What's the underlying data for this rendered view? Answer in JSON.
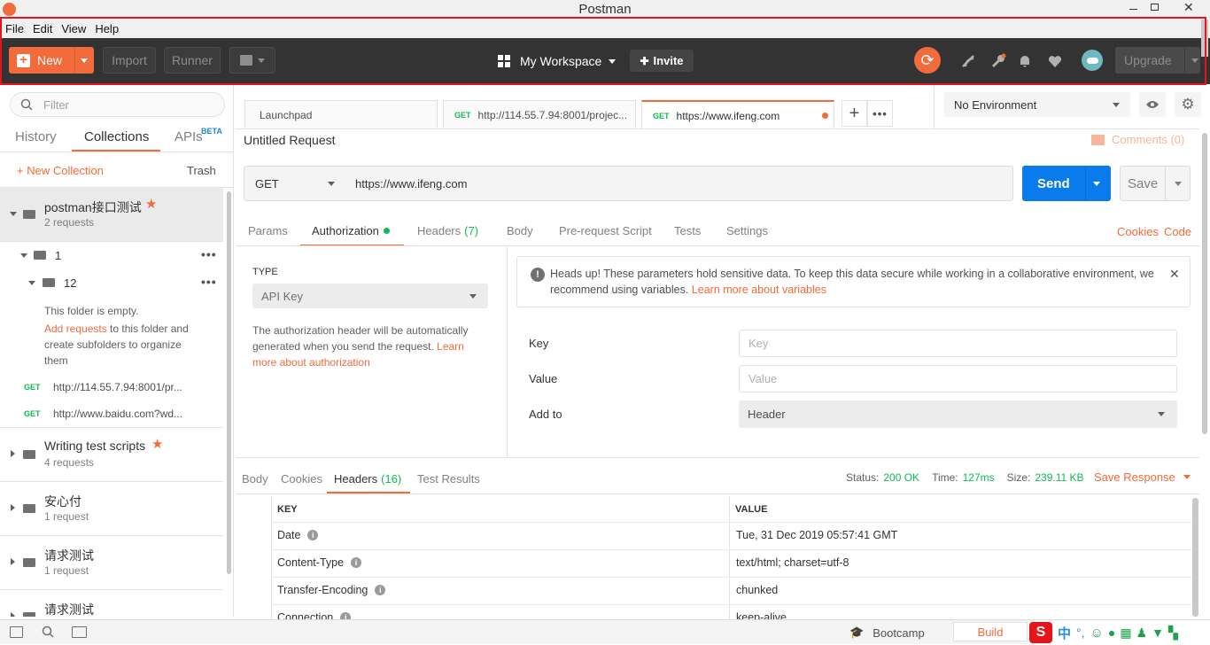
{
  "window": {
    "title": "Postman"
  },
  "menu": [
    "File",
    "Edit",
    "View",
    "Help"
  ],
  "toolbar": {
    "new_label": "New",
    "import_label": "Import",
    "runner_label": "Runner",
    "workspace_label": "My Workspace",
    "invite_label": "Invite",
    "upgrade_label": "Upgrade"
  },
  "sidebar": {
    "filter_placeholder": "Filter",
    "tabs": {
      "history": "History",
      "collections": "Collections",
      "apis": "APIs",
      "beta": "BETA"
    },
    "new_collection": "+ New Collection",
    "trash": "Trash",
    "collections": [
      {
        "name": "postman接口测试",
        "count": "2 requests",
        "starred": true
      },
      {
        "name": "Writing test scripts",
        "count": "4 requests",
        "starred": true
      },
      {
        "name": "安心付",
        "count": "1 request"
      },
      {
        "name": "请求测试",
        "count": "1 request"
      },
      {
        "name": "请求测试",
        "count": ""
      }
    ],
    "folder1": "1",
    "folder12": "12",
    "empty_text": "This folder is empty.",
    "add_requests": "Add requests",
    "empty_rest1": " to this folder and",
    "empty_rest2": "create subfolders to organize",
    "empty_rest3": "them",
    "requests": [
      {
        "method": "GET",
        "url": "http://114.55.7.94:8001/pr..."
      },
      {
        "method": "GET",
        "url": "http://www.baidu.com?wd..."
      }
    ]
  },
  "tabs": [
    {
      "label": "Launchpad"
    },
    {
      "method": "GET",
      "label": "http://114.55.7.94:8001/projec..."
    },
    {
      "method": "GET",
      "label": "https://www.ifeng.com"
    }
  ],
  "environment": {
    "selected": "No Environment"
  },
  "request": {
    "title": "Untitled Request",
    "comments": "Comments (0)",
    "method": "GET",
    "url": "https://www.ifeng.com",
    "send": "Send",
    "save": "Save"
  },
  "request_tabs": {
    "params": "Params",
    "authorization": "Authorization",
    "headers": "Headers",
    "headers_count": "(7)",
    "body": "Body",
    "prerequest": "Pre-request Script",
    "tests": "Tests",
    "settings": "Settings",
    "cookies": "Cookies",
    "code": "Code"
  },
  "auth": {
    "type_label": "TYPE",
    "type_value": "API Key",
    "desc1": "The authorization header will be automatically",
    "desc2": "generated when you send the request. ",
    "desc_link1": "Learn",
    "desc_link2": "more about authorization",
    "notice1": "Heads up! These parameters hold sensitive data. To keep this data secure while working in a collaborative environment, we",
    "notice2": "recommend using variables. ",
    "notice_link": "Learn more about variables",
    "key_label": "Key",
    "key_placeholder": "Key",
    "value_label": "Value",
    "value_placeholder": "Value",
    "addto_label": "Add to",
    "addto_value": "Header"
  },
  "response": {
    "tabs": {
      "body": "Body",
      "cookies": "Cookies",
      "headers": "Headers",
      "headers_count": "(16)",
      "test_results": "Test Results"
    },
    "status_label": "Status:",
    "status_value": "200 OK",
    "time_label": "Time:",
    "time_value": "127ms",
    "size_label": "Size:",
    "size_value": "239.11 KB",
    "save_response": "Save Response",
    "columns": [
      "KEY",
      "VALUE"
    ],
    "headers": [
      {
        "key": "Date",
        "value": "Tue, 31 Dec 2019 05:57:41 GMT"
      },
      {
        "key": "Content-Type",
        "value": "text/html; charset=utf-8"
      },
      {
        "key": "Transfer-Encoding",
        "value": "chunked"
      },
      {
        "key": "Connection",
        "value": "keep-alive"
      }
    ]
  },
  "statusbar": {
    "bootcamp": "Bootcamp",
    "build": "Build"
  },
  "ime": {
    "lang": "中"
  },
  "colors": {
    "accent": "#f26b3a",
    "send": "#097bed",
    "toolbar": "#333333",
    "highlight": "#e8141b"
  }
}
